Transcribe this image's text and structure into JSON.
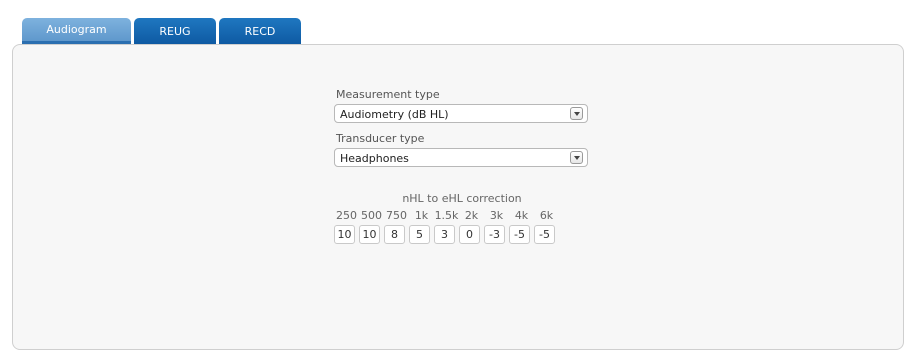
{
  "tabs": [
    {
      "label": "Audiogram",
      "active": true
    },
    {
      "label": "REUG",
      "active": false
    },
    {
      "label": "RECD",
      "active": false
    }
  ],
  "measurement": {
    "label": "Measurement type",
    "value": "Audiometry (dB HL)"
  },
  "transducer": {
    "label": "Transducer type",
    "value": "Headphones"
  },
  "correction": {
    "title": "nHL to eHL correction",
    "frequencies": [
      "250",
      "500",
      "750",
      "1k",
      "1.5k",
      "2k",
      "3k",
      "4k",
      "6k"
    ],
    "values": [
      "10",
      "10",
      "8",
      "5",
      "3",
      "0",
      "-3",
      "-5",
      "-5"
    ]
  },
  "colors": {
    "tab_active": "#6aa3d4",
    "tab_inactive": "#1565b0",
    "panel_bg": "#f7f7f7"
  },
  "icons": {
    "dropdown": "chevron-down-icon"
  }
}
